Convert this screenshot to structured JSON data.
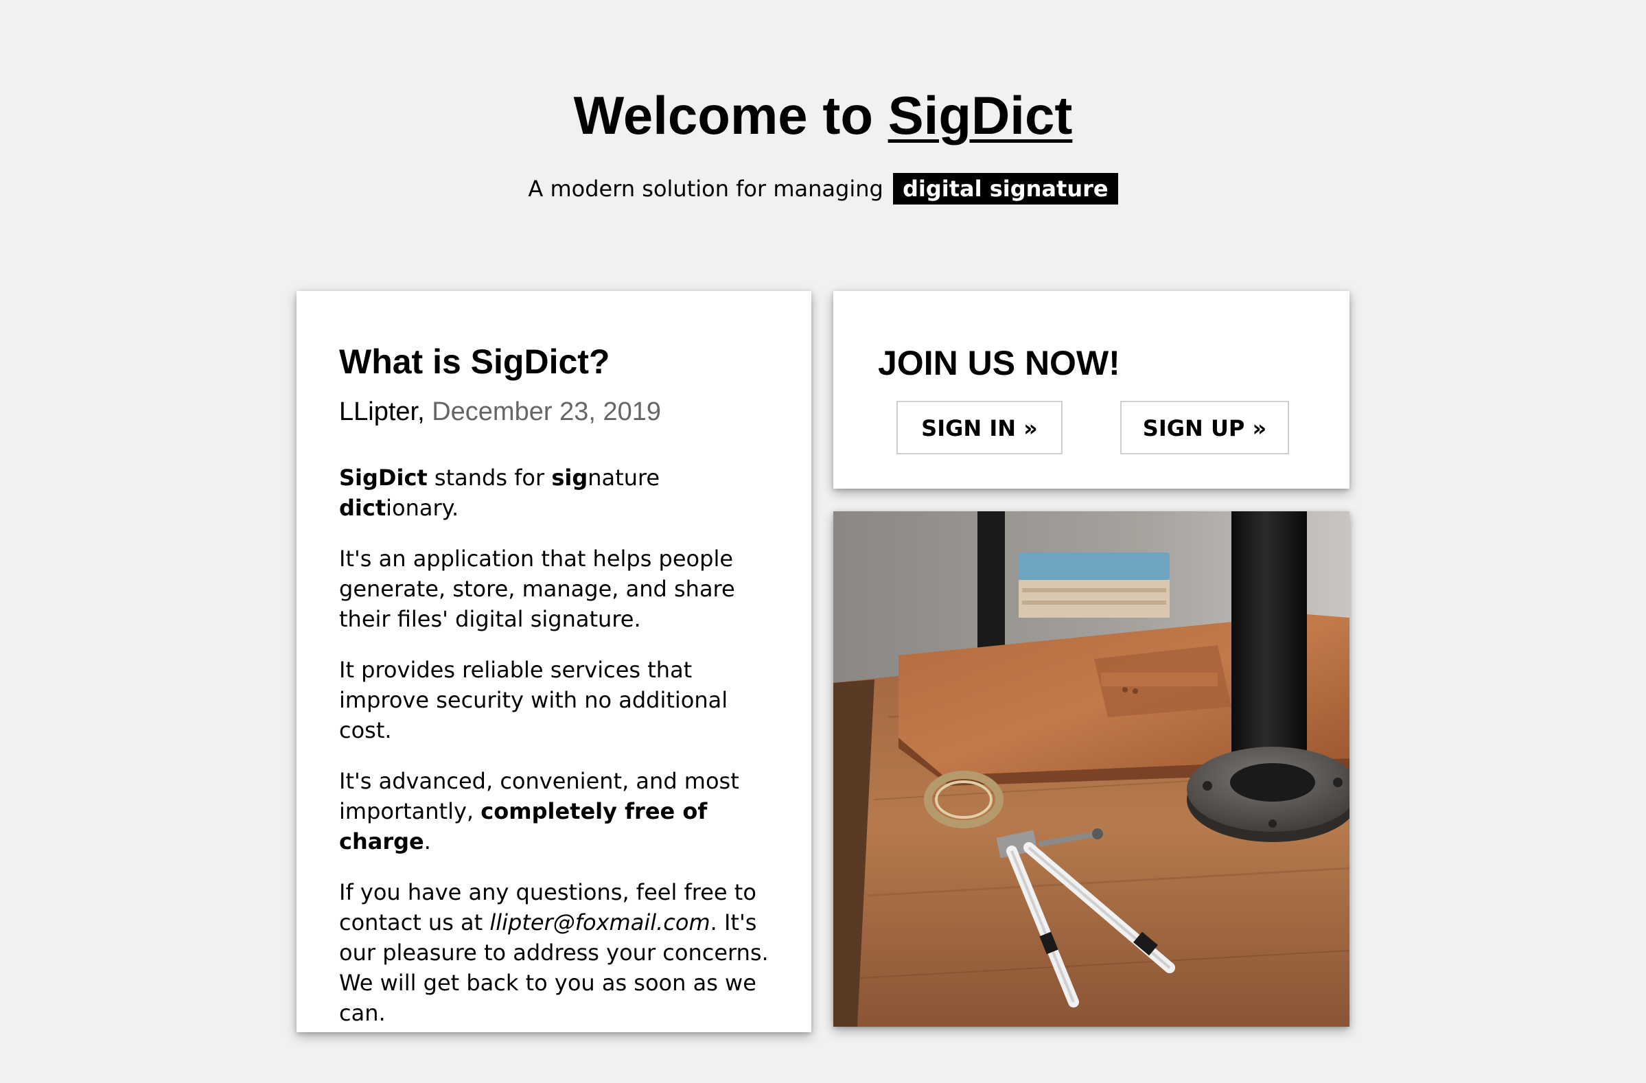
{
  "header": {
    "title_prefix": "Welcome to ",
    "brand_link": "SigDict",
    "subtitle_text": "A modern solution for managing",
    "subtitle_highlight": "digital signature"
  },
  "about": {
    "heading": "What is SigDict?",
    "author": "LLipter,",
    "date": "December 23, 2019",
    "p1": {
      "b1": "SigDict",
      "t1": " stands for ",
      "b2": "sig",
      "t2": "nature ",
      "b3": "dict",
      "t3": "ionary."
    },
    "p2": "It's an application that helps people generate, store, manage, and share their files' digital signature.",
    "p3": "It provides reliable services that improve security with no additional cost.",
    "p4": {
      "t1": "It's advanced, convenient, and most importantly, ",
      "b1": "completely free of charge",
      "t2": "."
    },
    "p5": {
      "t1": "If you have any questions, feel free to contact us at ",
      "email": "llipter@foxmail.com",
      "t2": ". It's our pleasure to address your concerns. We will get back to you as soon as we can."
    }
  },
  "join": {
    "heading": "JOIN US NOW!",
    "sign_in_label": "SIGN IN »",
    "sign_up_label": "SIGN UP »"
  },
  "colors": {
    "page_background": "#f1f1f1",
    "card_background": "#ffffff",
    "highlight_background": "#000000",
    "date_text": "#666666"
  },
  "photo": {
    "icon": "desk-photo-leather-folio-compass-pipe"
  }
}
